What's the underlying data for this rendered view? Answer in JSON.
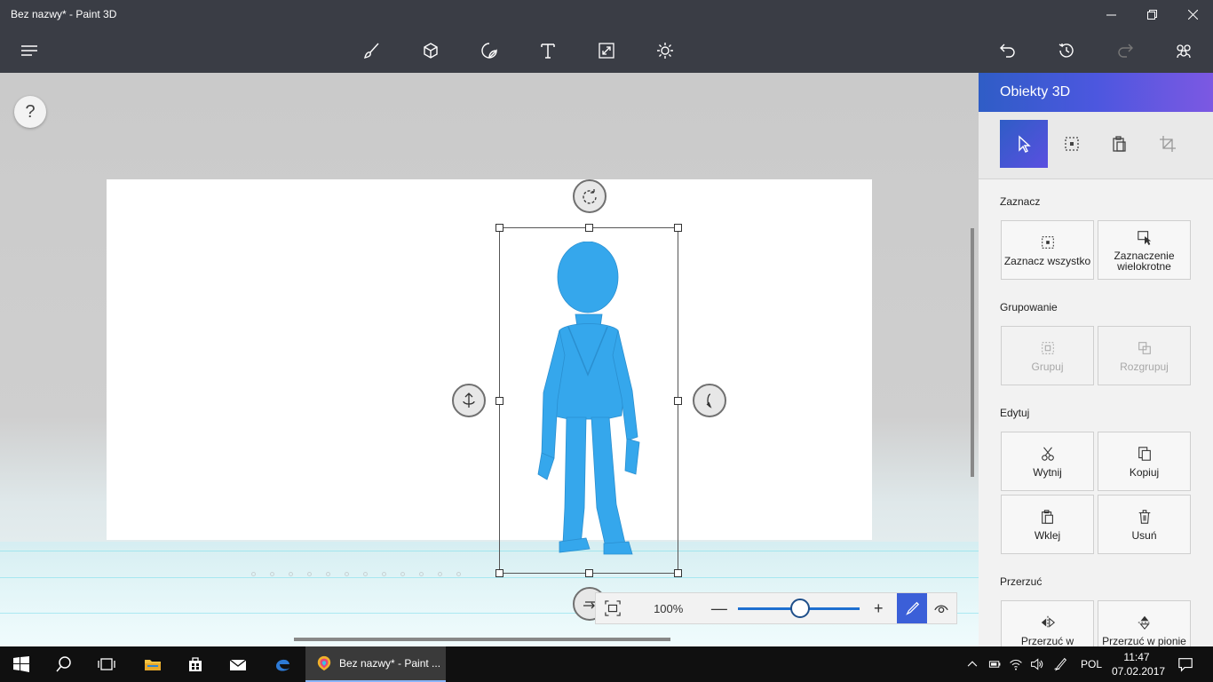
{
  "window": {
    "title": "Bez nazwy* - Paint 3D"
  },
  "toolbar": {
    "tools": [
      "brush-icon",
      "3d-cube-icon",
      "sticker-icon",
      "text-icon",
      "canvas-resize-icon",
      "effects-icon"
    ],
    "right": [
      "undo-icon",
      "history-icon",
      "redo-icon",
      "remix-community-icon"
    ]
  },
  "canvas": {
    "help_label": "?"
  },
  "zoom": {
    "percent_label": "100%",
    "minus": "—",
    "plus": "+",
    "level": 0.5
  },
  "panel": {
    "title": "Obiekty 3D",
    "tabs": [
      "select-icon",
      "select-box-icon",
      "paste-icon",
      "crop-icon"
    ],
    "sections": {
      "select": {
        "label": "Zaznacz",
        "select_all": "Zaznacz wszystko",
        "multi_select": "Zaznaczenie wielokrotne"
      },
      "group": {
        "label": "Grupowanie",
        "group": "Grupuj",
        "ungroup": "Rozgrupuj"
      },
      "edit": {
        "label": "Edytuj",
        "cut": "Wytnij",
        "copy": "Kopiuj",
        "paste": "Wklej",
        "delete": "Usuń"
      },
      "flip": {
        "label": "Przerzuć",
        "flip_h": "Przerzuć w",
        "flip_v": "Przerzuć w pionie"
      }
    }
  },
  "taskbar": {
    "app_label": "Bez nazwy* - Paint ...",
    "language": "POL",
    "time": "11:47",
    "date": "07.02.2017"
  },
  "colors": {
    "chrome": "#3a3d45",
    "accent": "#3b5fd8",
    "figure": "#35a7ec"
  }
}
